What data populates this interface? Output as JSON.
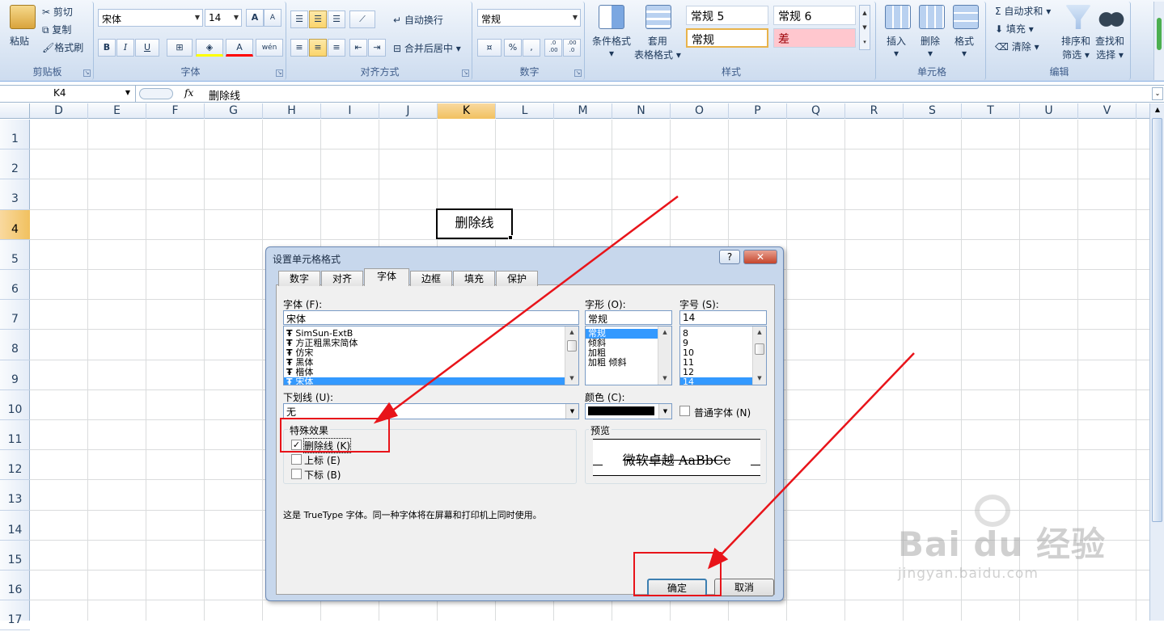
{
  "clipboard": {
    "paste": "粘贴",
    "cut": "剪切",
    "copy": "复制",
    "format_painter": "格式刷",
    "group": "剪贴板"
  },
  "font": {
    "name": "宋体",
    "size": "14",
    "group": "字体",
    "bold": "B",
    "italic": "I",
    "underline": "U",
    "grow": "A",
    "shrink": "A",
    "font_color": "A",
    "phonetic": "wén"
  },
  "alignment": {
    "wrap": "自动换行",
    "merge": "合并后居中",
    "group": "对齐方式"
  },
  "number": {
    "format": "常规",
    "group": "数字",
    "percent": "%",
    "comma": ",",
    "inc_decimal": ".0 .00",
    "dec_decimal": ".00 .0"
  },
  "styles": {
    "cond_format": "条件格式",
    "table_format_1": "套用",
    "table_format_2": "表格格式",
    "cells": [
      "常规 5",
      "常规 6",
      "常规",
      "差"
    ],
    "group": "样式"
  },
  "cells_group": {
    "insert": "插入",
    "delete": "删除",
    "format": "格式",
    "group": "单元格"
  },
  "editing": {
    "autosum": "自动求和",
    "fill": "填充",
    "clear": "清除",
    "sort_1": "排序和",
    "sort_2": "筛选",
    "find_1": "查找和",
    "find_2": "选择",
    "group": "编辑"
  },
  "formula_bar": {
    "name_box": "K4",
    "fx": "fx",
    "content": "删除线"
  },
  "sheet": {
    "columns": [
      "D",
      "E",
      "F",
      "G",
      "H",
      "I",
      "J",
      "K",
      "L",
      "M",
      "N",
      "O",
      "P",
      "Q",
      "R",
      "S",
      "T",
      "U",
      "V"
    ],
    "selected_col": "K",
    "rows": [
      "1",
      "2",
      "3",
      "4",
      "5",
      "6",
      "7",
      "8",
      "9",
      "10",
      "11",
      "12",
      "13",
      "14",
      "15",
      "16",
      "17"
    ],
    "selected_row": "4",
    "cell_k4": "删除线"
  },
  "dialog": {
    "title": "设置单元格格式",
    "help": "?",
    "close": "✕",
    "tabs": [
      "数字",
      "对齐",
      "字体",
      "边框",
      "填充",
      "保护"
    ],
    "active_tab": "字体",
    "font_label": "字体 (F):",
    "font_value": "宋体",
    "font_list": [
      "SimSun-ExtB",
      "方正粗黑宋简体",
      "仿宋",
      "黑体",
      "楷体",
      "宋体"
    ],
    "style_label": "字形 (O):",
    "style_value": "常规",
    "style_list": [
      "常规",
      "倾斜",
      "加粗",
      "加粗 倾斜"
    ],
    "size_label": "字号 (S):",
    "size_value": "14",
    "size_list": [
      "8",
      "9",
      "10",
      "11",
      "12",
      "14"
    ],
    "underline_label": "下划线 (U):",
    "underline_value": "无",
    "color_label": "颜色 (C):",
    "normal_font": "普通字体 (N)",
    "effects_label": "特殊效果",
    "strikethrough": "删除线 (K)",
    "strikethrough_checked": true,
    "superscript": "上标 (E)",
    "subscript": "下标 (B)",
    "preview_label": "预览",
    "preview_text": "微软卓越  AaBbCc",
    "info": "这是 TrueType 字体。同一种字体将在屏幕和打印机上同时使用。",
    "ok": "确定",
    "cancel": "取消"
  },
  "watermark": {
    "brand": "Bai du 经验",
    "url": "jingyan.baidu.com"
  }
}
